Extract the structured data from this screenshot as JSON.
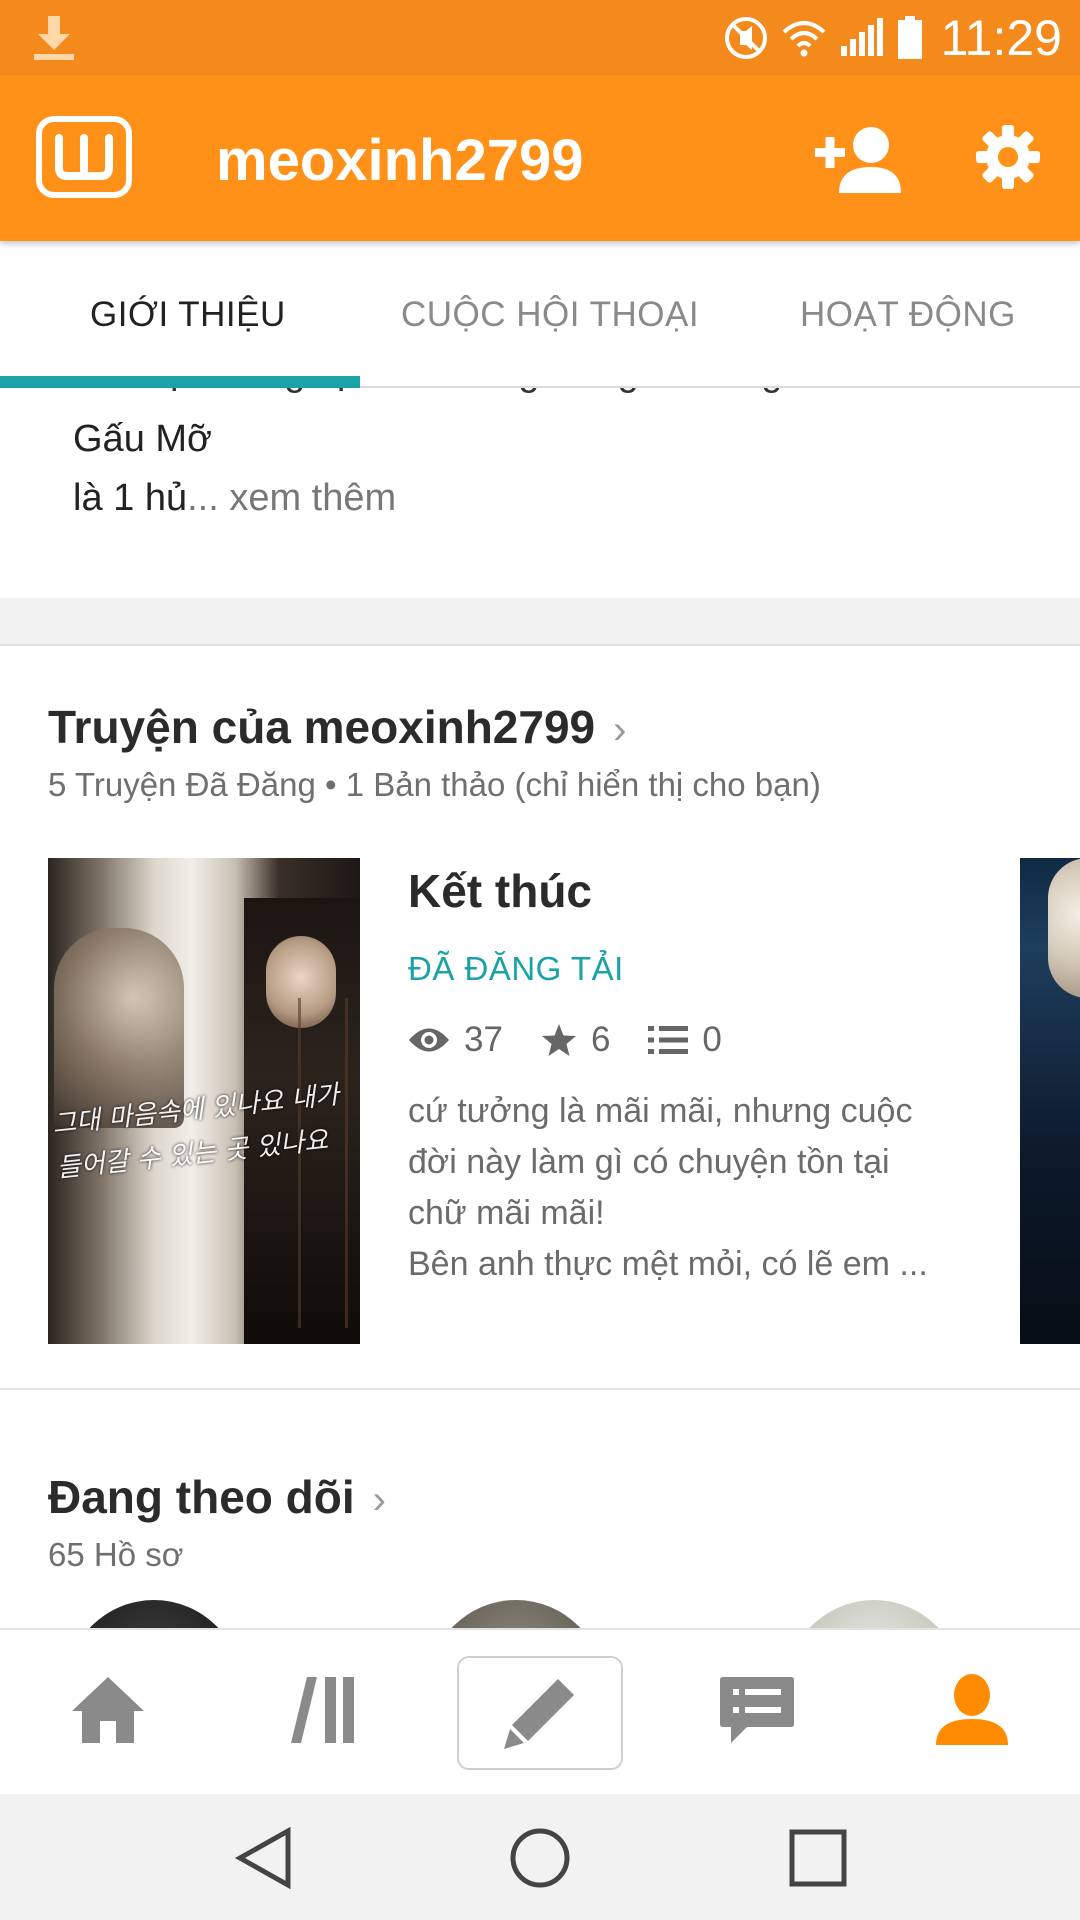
{
  "status_bar": {
    "time": "11:29",
    "icons": [
      "download-icon",
      "mute-icon",
      "wifi-icon",
      "signal-icon",
      "battery-icon"
    ]
  },
  "app_bar": {
    "logo": "W",
    "title": "meoxinh2799",
    "actions": [
      "add-friend-icon",
      "gear-icon"
    ]
  },
  "tabs": [
    {
      "label": "GIỚI THIỆU",
      "active": true
    },
    {
      "label": "CUỘC HỘI THOẠI",
      "active": false
    },
    {
      "label": "HOẠT ĐỘNG",
      "active": false
    }
  ],
  "about": {
    "cut_line": "thik đọc fic ngược tên Hồng Vàng và sủng con",
    "line1": "Gấu Mỡ",
    "line2_start": "là 1 hủ",
    "more": "... xem thêm"
  },
  "stories": {
    "title": "Truyện của meoxinh2799",
    "chevron": "›",
    "subtitle": "5 Truyện Đã Đăng • 1 Bản thảo (chỉ hiển thị cho bạn)",
    "items": [
      {
        "title": "Kết thúc",
        "status": "ĐÃ ĐĂNG TẢI",
        "reads": "37",
        "votes": "6",
        "parts": "0",
        "cover_text": "그대 마음속에 있나요 내가 들어갈 수 있는 곳 있나요",
        "description": [
          "cứ tưởng là mãi mãi, nhưng cuộc",
          "đời này làm gì có chuyện tồn tại",
          "chữ mãi mãi!",
          "Bên anh thực mệt mỏi, có lẽ em ..."
        ]
      }
    ]
  },
  "following": {
    "title": "Đang theo dõi",
    "chevron": "›",
    "subtitle": "65 Hồ sơ"
  },
  "bottom_nav": [
    "home-icon",
    "library-icon",
    "write-icon",
    "messages-icon",
    "profile-icon"
  ],
  "colors": {
    "status_bar": "#f58a1c",
    "app_bar": "#ff9118",
    "accent": "#1aa2a6",
    "active_nav": "#ff8c00",
    "inactive_icon": "#8a8a8a"
  }
}
